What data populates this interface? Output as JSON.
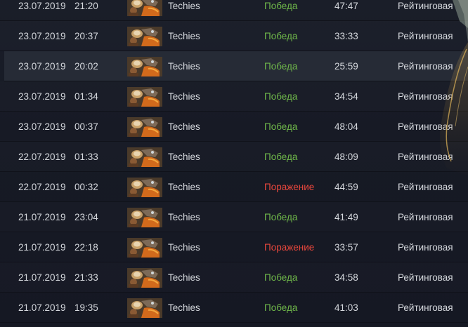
{
  "matches": [
    {
      "date": "23.07.2019",
      "time": "21:20",
      "hero": "Techies",
      "result": "Победа",
      "outcome": "win",
      "duration": "47:47",
      "mode": "Рейтинговая"
    },
    {
      "date": "23.07.2019",
      "time": "20:37",
      "hero": "Techies",
      "result": "Победа",
      "outcome": "win",
      "duration": "33:33",
      "mode": "Рейтинговая"
    },
    {
      "date": "23.07.2019",
      "time": "20:02",
      "hero": "Techies",
      "result": "Победа",
      "outcome": "win",
      "duration": "25:59",
      "mode": "Рейтинговая"
    },
    {
      "date": "23.07.2019",
      "time": "01:34",
      "hero": "Techies",
      "result": "Победа",
      "outcome": "win",
      "duration": "34:54",
      "mode": "Рейтинговая"
    },
    {
      "date": "23.07.2019",
      "time": "00:37",
      "hero": "Techies",
      "result": "Победа",
      "outcome": "win",
      "duration": "48:04",
      "mode": "Рейтинговая"
    },
    {
      "date": "22.07.2019",
      "time": "01:33",
      "hero": "Techies",
      "result": "Победа",
      "outcome": "win",
      "duration": "48:09",
      "mode": "Рейтинговая"
    },
    {
      "date": "22.07.2019",
      "time": "00:32",
      "hero": "Techies",
      "result": "Поражение",
      "outcome": "loss",
      "duration": "44:59",
      "mode": "Рейтинговая"
    },
    {
      "date": "21.07.2019",
      "time": "23:04",
      "hero": "Techies",
      "result": "Победа",
      "outcome": "win",
      "duration": "41:49",
      "mode": "Рейтинговая"
    },
    {
      "date": "21.07.2019",
      "time": "22:18",
      "hero": "Techies",
      "result": "Поражение",
      "outcome": "loss",
      "duration": "33:57",
      "mode": "Рейтинговая"
    },
    {
      "date": "21.07.2019",
      "time": "21:33",
      "hero": "Techies",
      "result": "Победа",
      "outcome": "win",
      "duration": "34:58",
      "mode": "Рейтинговая"
    },
    {
      "date": "21.07.2019",
      "time": "19:35",
      "hero": "Techies",
      "result": "Победа",
      "outcome": "win",
      "duration": "41:03",
      "mode": "Рейтинговая"
    }
  ],
  "highlighted_row": 2,
  "hero_icon": "techies-portrait-icon",
  "colors": {
    "win": "#6fb74a",
    "loss": "#e8473c",
    "text": "#d6d9de",
    "background": "#171a24",
    "highlight": "#262b36"
  }
}
